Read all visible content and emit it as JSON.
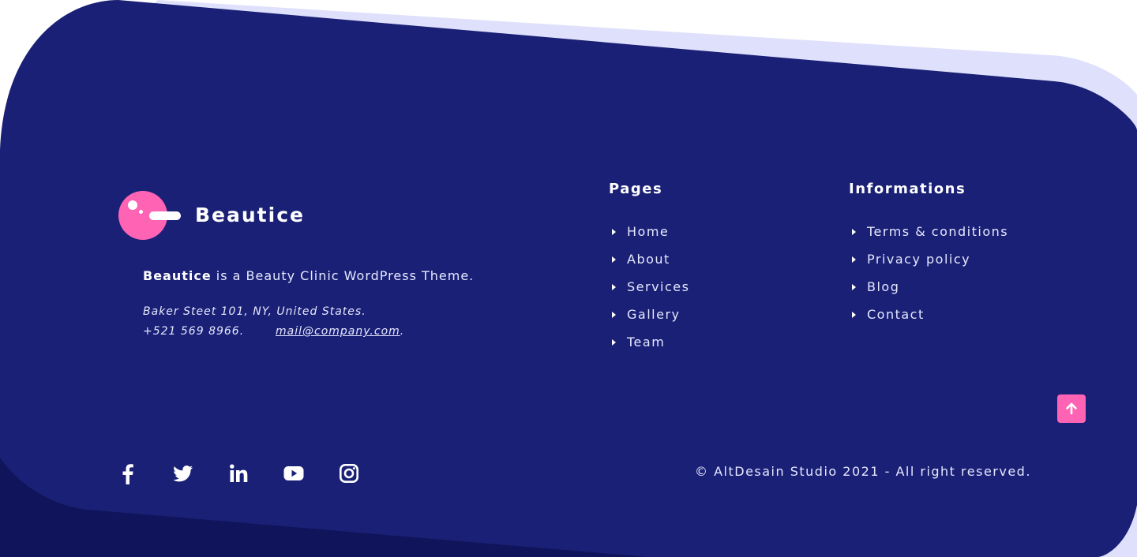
{
  "colors": {
    "footer_bg": "#1a2075",
    "footer_dark": "#10145a",
    "accent_lavender": "#dfe0fb",
    "accent_pink": "#ff64b4",
    "text_light": "#e6e8ff"
  },
  "brand": {
    "name": "Beautice",
    "logo_icon": "beautice-logo-icon",
    "tagline_bold": "Beautice",
    "tagline_rest": " is a Beauty Clinic WordPress Theme."
  },
  "contact": {
    "address": "Baker Steet 101, NY, United States.",
    "phone": "+521 569 8966.",
    "email": "mail@company.com",
    "email_suffix": "."
  },
  "pages": {
    "title": "Pages",
    "items": [
      "Home",
      "About",
      "Services",
      "Gallery",
      "Team"
    ]
  },
  "informations": {
    "title": "Informations",
    "items": [
      "Terms & conditions",
      "Privacy policy",
      "Blog",
      "Contact"
    ]
  },
  "social": {
    "icons": [
      "facebook-icon",
      "twitter-icon",
      "linkedin-icon",
      "youtube-icon",
      "instagram-icon"
    ]
  },
  "back_to_top_icon": "arrow-up-icon",
  "copyright": "© AltDesain Studio 2021 - All right reserved."
}
